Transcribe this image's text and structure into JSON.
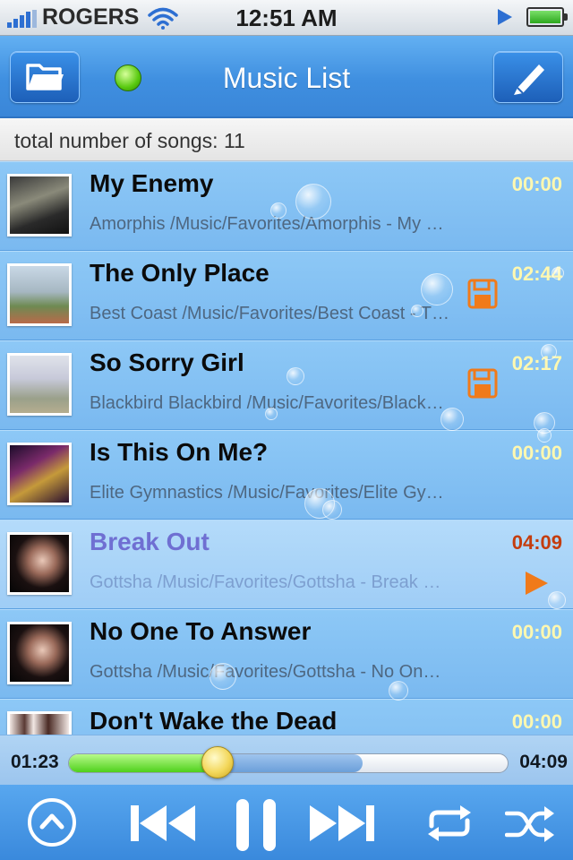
{
  "status_bar": {
    "carrier": "ROGERS",
    "time": "12:51 AM",
    "signal_bars": 4,
    "battery_level": 1.0
  },
  "nav": {
    "title": "Music List",
    "left_button_icon": "folder-icon",
    "right_button_icon": "pencil-icon",
    "status_light_color": "#58c90f"
  },
  "info": {
    "song_count_text": "total number of songs: 11"
  },
  "songs": [
    {
      "title": "My Enemy",
      "subtitle": "Amorphis /Music/Favorites/Amorphis - My Enemy",
      "duration": "00:00",
      "saved": false,
      "playing": false
    },
    {
      "title": "The Only Place",
      "subtitle": "Best Coast /Music/Favorites/Best Coast - The Only Place",
      "duration": "02:44",
      "saved": true,
      "playing": false
    },
    {
      "title": "So Sorry Girl",
      "subtitle": "Blackbird Blackbird /Music/Favorites/Blackbird Blackbird - So Sorry Girl",
      "duration": "02:17",
      "saved": true,
      "playing": false
    },
    {
      "title": "Is This On Me?",
      "subtitle": "Elite Gymnastics /Music/Favorites/Elite Gymnastics - Is This On Me?",
      "duration": "00:00",
      "saved": false,
      "playing": false
    },
    {
      "title": "Break Out",
      "subtitle": "Gottsha /Music/Favorites/Gottsha - Break Out",
      "duration": "04:09",
      "saved": false,
      "playing": true
    },
    {
      "title": "No One To Answer",
      "subtitle": "Gottsha /Music/Favorites/Gottsha - No One To Answer",
      "duration": "00:00",
      "saved": false,
      "playing": false
    },
    {
      "title": "Don't Wake the Dead",
      "subtitle": "",
      "duration": "00:00",
      "saved": false,
      "playing": false
    }
  ],
  "player": {
    "current_time": "01:23",
    "total_time": "04:09",
    "played_fraction": 0.34,
    "buffered_fraction": 0.67
  },
  "controls": {
    "collapse_icon": "chevron-up-circle-icon",
    "prev_icon": "skip-back-icon",
    "pause_icon": "pause-icon",
    "next_icon": "skip-forward-icon",
    "repeat_icon": "repeat-icon",
    "shuffle_icon": "shuffle-icon"
  },
  "colors": {
    "accent_blue": "#3f8fe0",
    "active_title": "#6f6fd2",
    "active_duration": "#c43d0e",
    "duration_yellow": "#fff8b0",
    "icon_orange": "#f07a1a"
  }
}
